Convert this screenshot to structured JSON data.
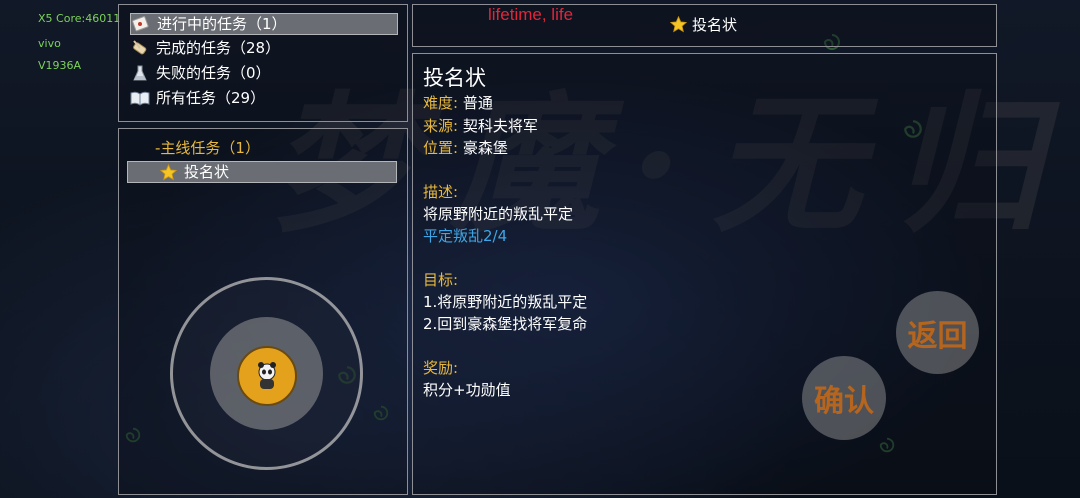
{
  "system_overlay": {
    "core": "X5 Core:46011",
    "brand": "vivo",
    "model": "V1936A"
  },
  "banner_text": "lifetime, life",
  "background_watermark": "梦魔·无归",
  "task_categories": [
    {
      "label": "进行中的任务（1）",
      "icon": "scroll-card-icon",
      "selected": true
    },
    {
      "label": "完成的任务（28）",
      "icon": "quill-scroll-icon",
      "selected": false
    },
    {
      "label": "失败的任务（0）",
      "icon": "flask-icon",
      "selected": false
    },
    {
      "label": "所有任务（29）",
      "icon": "book-icon",
      "selected": false
    }
  ],
  "task_tree": {
    "group_label": "-主线任务（1）",
    "items": [
      {
        "label": "投名状",
        "icon": "star-icon",
        "selected": true
      }
    ]
  },
  "header": {
    "title": "投名状",
    "icon": "star-icon"
  },
  "detail": {
    "title": "投名状",
    "difficulty_label": "难度:",
    "difficulty_value": "普通",
    "source_label": "来源:",
    "source_value": "契科夫将军",
    "location_label": "位置:",
    "location_value": "豪森堡",
    "description_label": "描述:",
    "description_text": "将原野附近的叛乱平定",
    "progress_text": "平定叛乱2/4",
    "goal_label": "目标:",
    "goals": [
      "1.将原野附近的叛乱平定",
      "2.回到豪森堡找将军复命"
    ],
    "reward_label": "奖励:",
    "reward_text": "积分+功勋值"
  },
  "buttons": {
    "back": "返回",
    "confirm": "确认"
  },
  "colors": {
    "label_gold": "#e8b93e",
    "progress_blue": "#3ea6e6",
    "button_text": "#b5651d",
    "panel_border": "#8d8f94",
    "selected_row": "#6a6d73",
    "overlay_green": "#7dd35a",
    "banner_red": "#e0263a"
  }
}
